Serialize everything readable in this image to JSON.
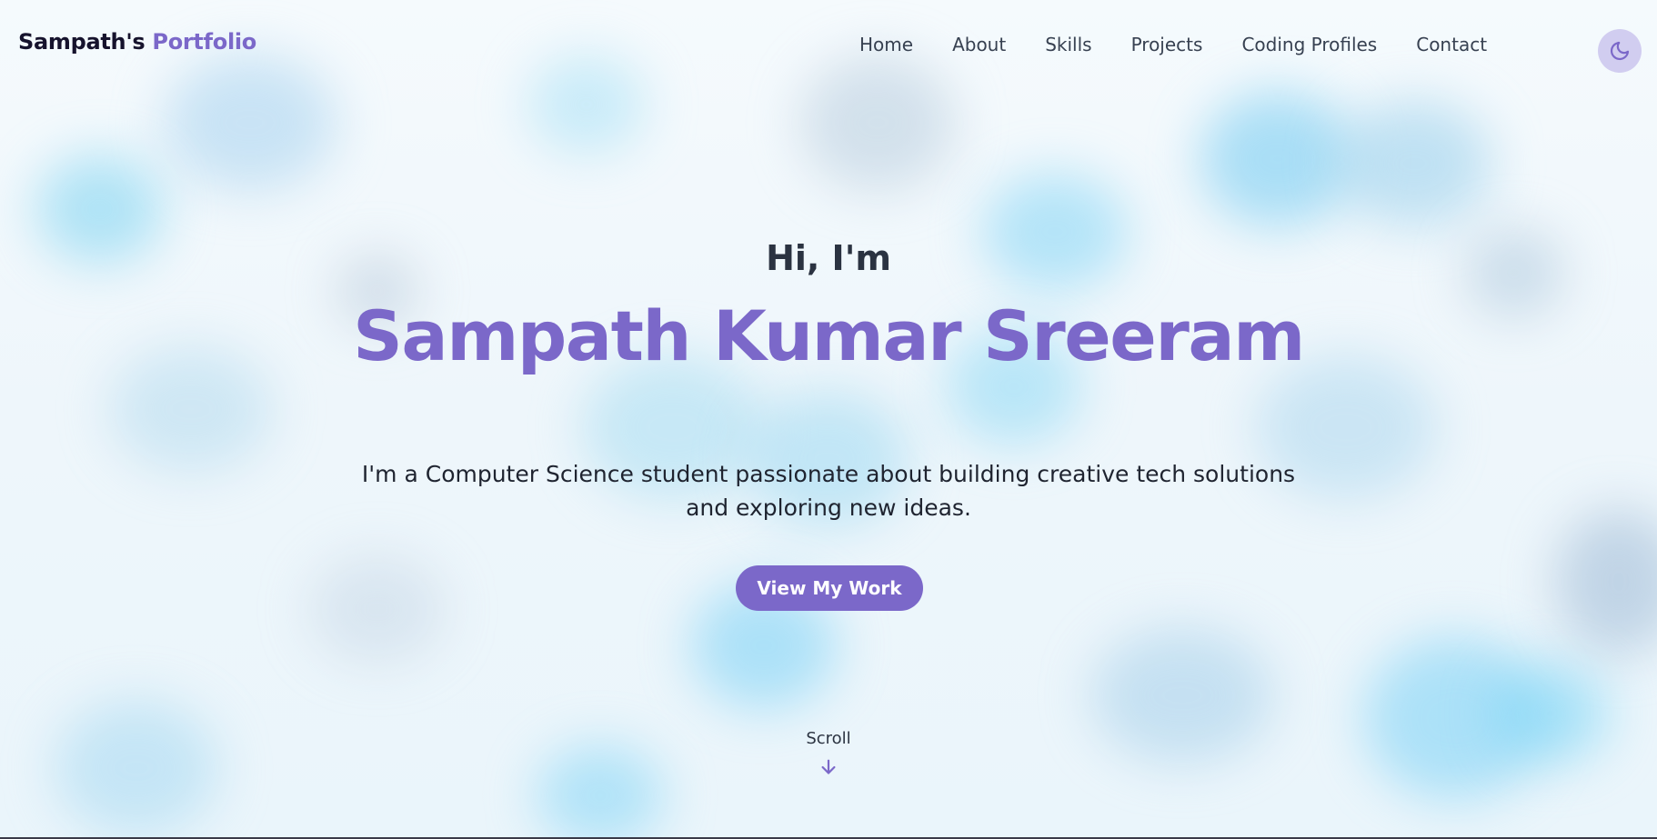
{
  "navbar": {
    "logo_main": "Sampath's",
    "logo_accent": "Portfolio",
    "links": [
      {
        "label": "Home"
      },
      {
        "label": "About"
      },
      {
        "label": "Skills"
      },
      {
        "label": "Projects"
      },
      {
        "label": "Coding Profiles"
      },
      {
        "label": "Contact"
      }
    ],
    "theme_toggle_icon": "moon-icon"
  },
  "hero": {
    "greeting": "Hi, I'm",
    "name": "Sampath Kumar Sreeram",
    "tagline": "I'm a Computer Science student passionate about building creative tech solutions and exploring new ideas.",
    "cta_label": "View My Work",
    "scroll_label": "Scroll",
    "scroll_icon": "arrow-down-icon"
  },
  "colors": {
    "accent": "#7b68c9",
    "toggle_bg": "#d1cdf0",
    "text_dark": "#16132d",
    "background": "#f1f7fb"
  }
}
